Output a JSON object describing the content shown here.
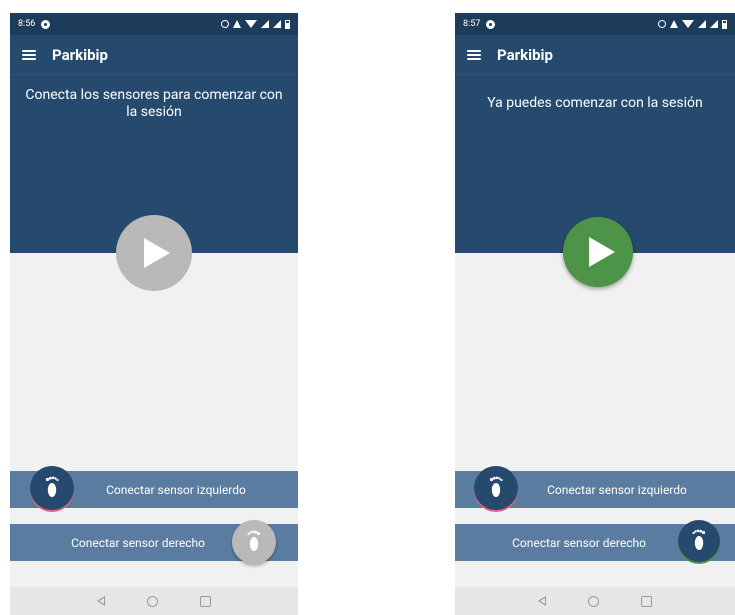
{
  "colors": {
    "primary": "#264a6d",
    "status_bar": "#1d3c5c",
    "sensor_bar": "#5b7ca1",
    "play_disabled": "#b9b9b9",
    "play_enabled": "#4d9448",
    "left_sensor_ring": "#e2627d",
    "right_sensor_ring": "#4d9448"
  },
  "screens": [
    {
      "status_bar": {
        "time": "8:56"
      },
      "app_bar": {
        "title": "Parkibip",
        "menu_icon": "menu-icon"
      },
      "hero": {
        "message": "Conecta los sensores para comenzar con la sesión"
      },
      "play_button": {
        "icon": "play-icon",
        "state": "disabled"
      },
      "sensor_left": {
        "label": "Conectar sensor izquierdo",
        "icon": "footprint-left-icon"
      },
      "sensor_right": {
        "label": "Conectar sensor derecho",
        "icon": "footprint-right-icon",
        "state": "disconnected"
      }
    },
    {
      "status_bar": {
        "time": "8:57"
      },
      "app_bar": {
        "title": "Parkibip",
        "menu_icon": "menu-icon"
      },
      "hero": {
        "message": "Ya puedes comenzar con la sesión"
      },
      "play_button": {
        "icon": "play-icon",
        "state": "enabled"
      },
      "sensor_left": {
        "label": "Conectar sensor izquierdo",
        "icon": "footprint-left-icon"
      },
      "sensor_right": {
        "label": "Conectar sensor derecho",
        "icon": "footprint-right-icon",
        "state": "connected"
      }
    }
  ]
}
